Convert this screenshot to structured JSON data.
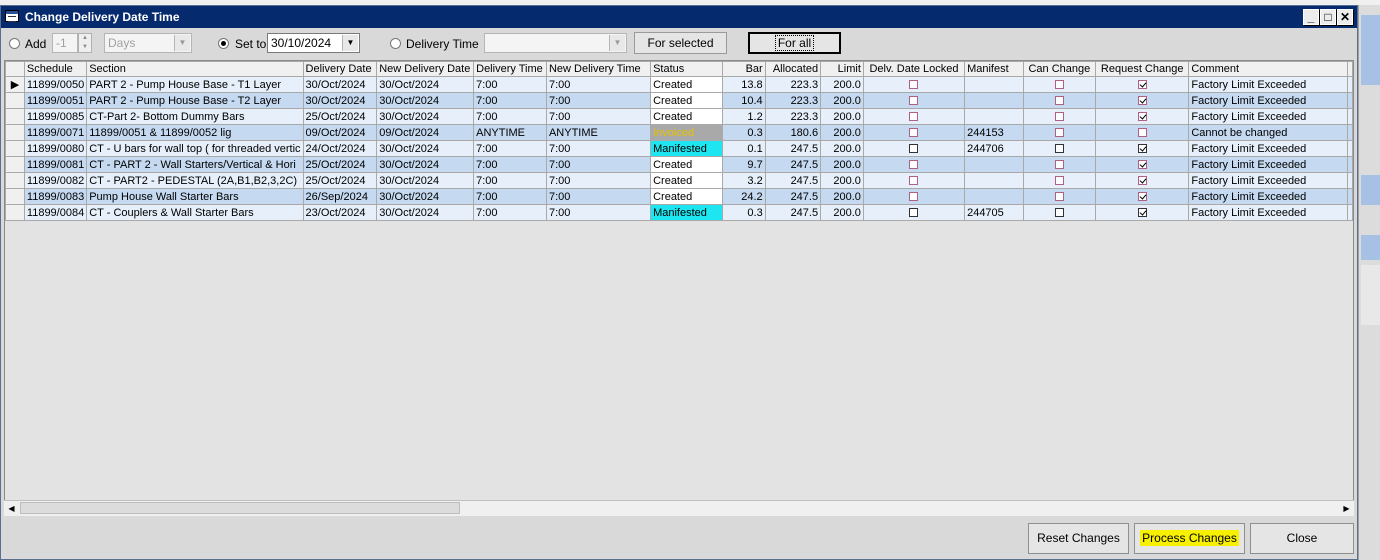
{
  "window": {
    "title": "Change Delivery Date Time"
  },
  "toolbar": {
    "add_label": "Add",
    "add_value": "-1",
    "unit_value": "Days",
    "setto_label": "Set to",
    "setto_value": "30/10/2024",
    "delivery_time_label": "Delivery Time",
    "delivery_time_value": "",
    "for_selected_label": "For selected",
    "for_all_label": "For all"
  },
  "grid": {
    "columns": [
      "Schedule",
      "Section",
      "Delivery Date",
      "New Delivery Date",
      "Delivery Time",
      "New Delivery Time",
      "Status",
      "Bar",
      "Allocated",
      "Limit",
      "Delv. Date Locked",
      "Manifest",
      "Can Change",
      "Request Change",
      "Comment"
    ],
    "rows": [
      {
        "schedule": "11899/0050",
        "section": "PART 2 - Pump House Base - T1 Layer",
        "delivery_date": "30/Oct/2024",
        "new_delivery_date": "30/Oct/2024",
        "delivery_time": "7:00",
        "new_delivery_time": "7:00",
        "status": "Created",
        "bar": "13.8",
        "allocated": "223.3",
        "limit": "200.0",
        "manifest": "",
        "request_change": true,
        "comment": "Factory Limit Exceeded"
      },
      {
        "schedule": "11899/0051",
        "section": "PART 2 - Pump House Base - T2 Layer",
        "delivery_date": "30/Oct/2024",
        "new_delivery_date": "30/Oct/2024",
        "delivery_time": "7:00",
        "new_delivery_time": "7:00",
        "status": "Created",
        "bar": "10.4",
        "allocated": "223.3",
        "limit": "200.0",
        "manifest": "",
        "request_change": true,
        "comment": "Factory Limit Exceeded"
      },
      {
        "schedule": "11899/0085",
        "section": "CT-Part 2- Bottom Dummy Bars",
        "delivery_date": "25/Oct/2024",
        "new_delivery_date": "30/Oct/2024",
        "delivery_time": "7:00",
        "new_delivery_time": "7:00",
        "status": "Created",
        "bar": "1.2",
        "allocated": "223.3",
        "limit": "200.0",
        "manifest": "",
        "request_change": true,
        "comment": "Factory Limit Exceeded"
      },
      {
        "schedule": "11899/0071",
        "section": "11899/0051 & 11899/0052 lig",
        "delivery_date": "09/Oct/2024",
        "new_delivery_date": "09/Oct/2024",
        "delivery_time": "ANYTIME",
        "new_delivery_time": "ANYTIME",
        "status": "Invoiced",
        "bar": "0.3",
        "allocated": "180.6",
        "limit": "200.0",
        "manifest": "244153",
        "request_change": false,
        "comment": "Cannot be changed"
      },
      {
        "schedule": "11899/0080",
        "section": "CT - U bars for wall top ( for threaded vertic",
        "delivery_date": "24/Oct/2024",
        "new_delivery_date": "30/Oct/2024",
        "delivery_time": "7:00",
        "new_delivery_time": "7:00",
        "status": "Manifested",
        "bar": "0.1",
        "allocated": "247.5",
        "limit": "200.0",
        "manifest": "244706",
        "request_change": true,
        "comment": "Factory Limit Exceeded"
      },
      {
        "schedule": "11899/0081",
        "section": "CT - PART 2  - Wall Starters/Vertical & Hori",
        "delivery_date": "25/Oct/2024",
        "new_delivery_date": "30/Oct/2024",
        "delivery_time": "7:00",
        "new_delivery_time": "7:00",
        "status": "Created",
        "bar": "9.7",
        "allocated": "247.5",
        "limit": "200.0",
        "manifest": "",
        "request_change": true,
        "comment": "Factory Limit Exceeded"
      },
      {
        "schedule": "11899/0082",
        "section": "CT - PART2 - PEDESTAL (2A,B1,B2,3,2C)",
        "delivery_date": "25/Oct/2024",
        "new_delivery_date": "30/Oct/2024",
        "delivery_time": "7:00",
        "new_delivery_time": "7:00",
        "status": "Created",
        "bar": "3.2",
        "allocated": "247.5",
        "limit": "200.0",
        "manifest": "",
        "request_change": true,
        "comment": "Factory Limit Exceeded"
      },
      {
        "schedule": "11899/0083",
        "section": "Pump House Wall Starter Bars",
        "delivery_date": "26/Sep/2024",
        "new_delivery_date": "30/Oct/2024",
        "delivery_time": "7:00",
        "new_delivery_time": "7:00",
        "status": "Created",
        "bar": "24.2",
        "allocated": "247.5",
        "limit": "200.0",
        "manifest": "",
        "request_change": true,
        "comment": "Factory Limit Exceeded"
      },
      {
        "schedule": "11899/0084",
        "section": "CT - Couplers & Wall Starter Bars",
        "delivery_date": "23/Oct/2024",
        "new_delivery_date": "30/Oct/2024",
        "delivery_time": "7:00",
        "new_delivery_time": "7:00",
        "status": "Manifested",
        "bar": "0.3",
        "allocated": "247.5",
        "limit": "200.0",
        "manifest": "244705",
        "request_change": true,
        "comment": "Factory Limit Exceeded"
      }
    ]
  },
  "footer": {
    "reset_label": "Reset Changes",
    "process_label": "Process Changes",
    "close_label": "Close"
  },
  "colors": {
    "titlebar": "#062a6e",
    "row_alt": "#c5d9f1",
    "manifested": "#1ee6f0",
    "invoiced": "#a9a9a9",
    "highlight": "#f7f000"
  }
}
